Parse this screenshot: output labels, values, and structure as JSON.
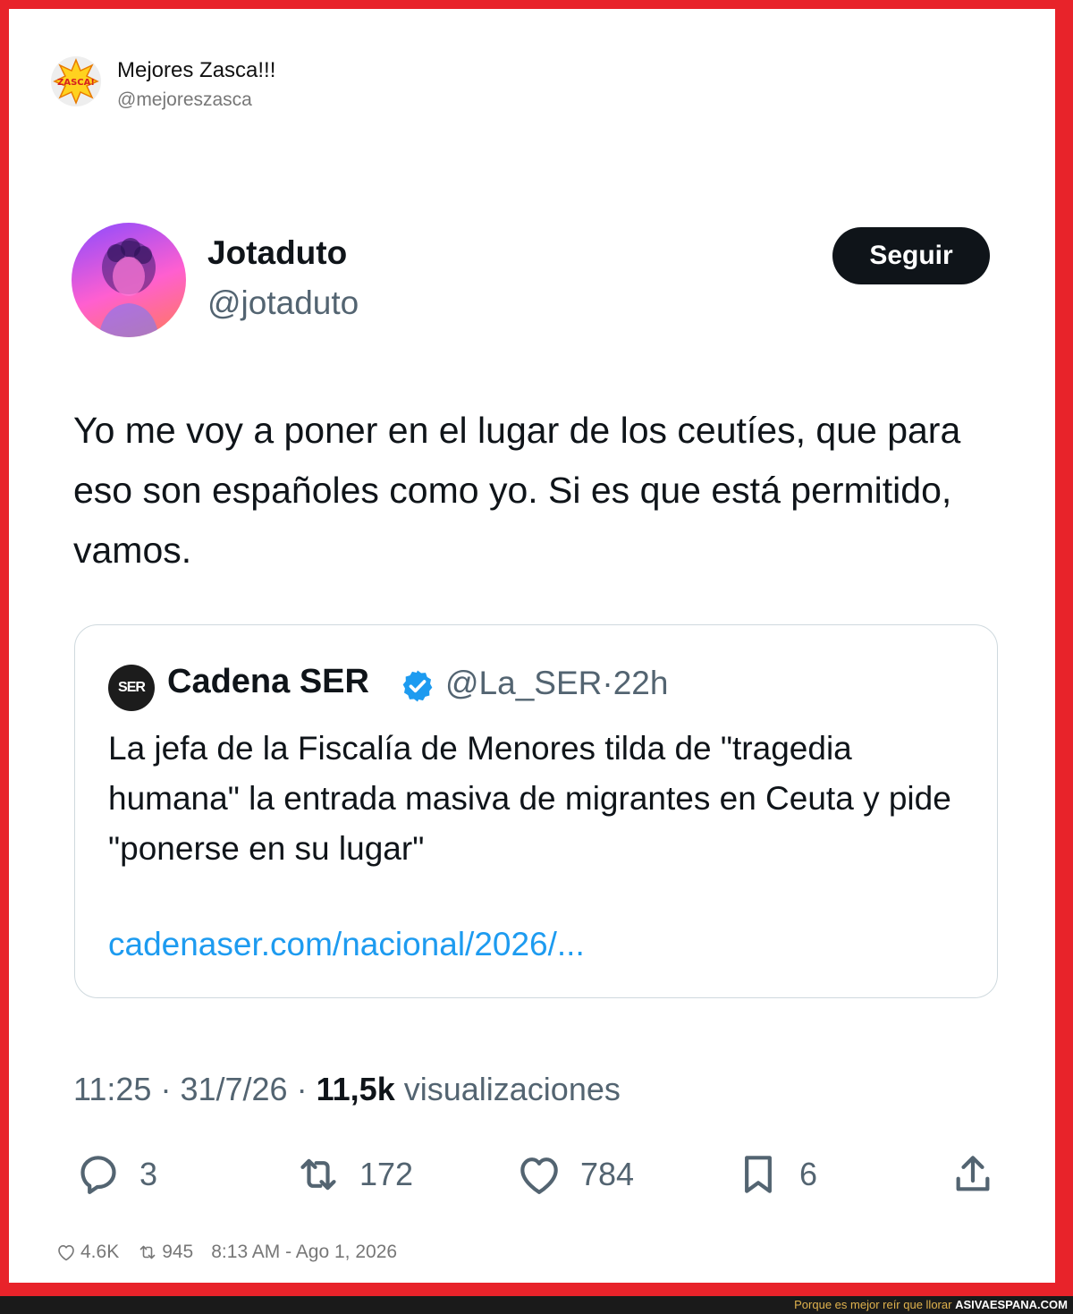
{
  "outer_account": {
    "name": "Mejores Zasca!!!",
    "handle": "@mejoreszasca",
    "avatar_text": "ZASCA!"
  },
  "tweet": {
    "author_name": "Jotaduto",
    "author_handle": "@jotaduto",
    "follow_label": "Seguir",
    "text": "Yo me voy a poner en el lugar de los ceutíes, que para eso son españoles como yo. Si es que está permitido, vamos.",
    "time": "11:25",
    "date": "31/7/26",
    "views_count": "11,5k",
    "views_label": "visualizaciones",
    "separator": "·"
  },
  "quoted": {
    "logo_text": "SER",
    "name": "Cadena SER",
    "handle": "@La_SER",
    "age": "22h",
    "text": "La jefa de la Fiscalía de Menores tilda de \"tragedia humana\" la entrada masiva de migrantes en Ceuta y pide \"ponerse en su lugar\"",
    "link": "cadenaser.com/nacional/2026/..."
  },
  "actions": {
    "replies": "3",
    "retweets": "172",
    "likes": "784",
    "bookmarks": "6"
  },
  "outer_meta": {
    "likes": "4.6K",
    "retweets": "945",
    "timestamp": "8:13 AM - Ago 1, 2026"
  },
  "footer": {
    "slogan": "Porque es mejor reír que llorar",
    "site": "ASIVAESPANA.COM"
  },
  "colors": {
    "frame": "#e8232a",
    "link": "#1d9bf0",
    "verified": "#1d9bf0",
    "button_bg": "#0f1419"
  }
}
